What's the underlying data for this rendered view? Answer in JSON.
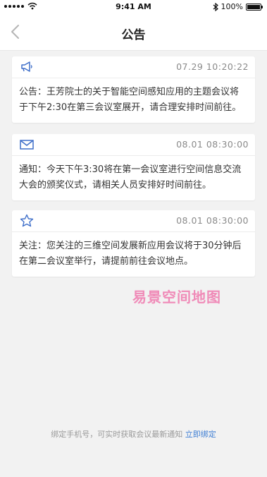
{
  "status_bar": {
    "time": "9:41 AM",
    "battery": "100%",
    "battery_level": 1.0
  },
  "nav": {
    "title": "公告"
  },
  "notices": [
    {
      "icon": "megaphone-icon",
      "time": "07.29 10:20:22",
      "text": "公告：王芳院士的关于智能空间感知应用的主题会议将于下午2:30在第三会议室展开，请合理安排时间前往。"
    },
    {
      "icon": "mail-icon",
      "time": "08.01 08:30:00",
      "text": "通知：今天下午3:30将在第一会议室进行空间信息交流大会的颁奖仪式，请相关人员安排好时间前往。"
    },
    {
      "icon": "star-icon",
      "time": "08.01 08:30:00",
      "text": "关注：您关注的三维空间发展新应用会议将于30分钟后在第二会议室举行，请提前前往会议地点。"
    }
  ],
  "watermark": "易景空间地图",
  "footer": {
    "text": "绑定手机号，可实时获取会议最新通知",
    "link": "立即绑定"
  },
  "colors": {
    "accent": "#3f7fd4",
    "watermark": "#f08bb8",
    "background": "#f2f2f2"
  }
}
